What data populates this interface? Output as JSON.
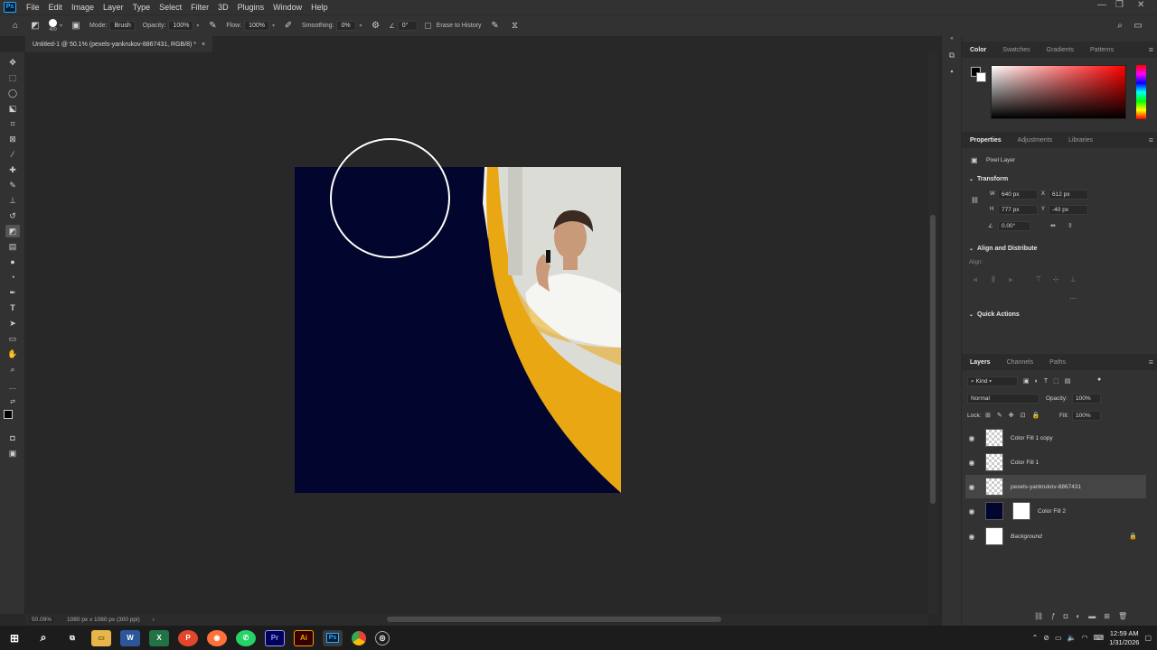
{
  "menubar": {
    "logo": "Ps",
    "items": [
      "File",
      "Edit",
      "Image",
      "Layer",
      "Type",
      "Select",
      "Filter",
      "3D",
      "Plugins",
      "Window",
      "Help"
    ]
  },
  "options": {
    "brush_size": "400",
    "mode_label": "Mode:",
    "mode_value": "Brush",
    "opacity_label": "Opacity:",
    "opacity_value": "100%",
    "flow_label": "Flow:",
    "flow_value": "100%",
    "smoothing_label": "Smoothing:",
    "smoothing_value": "0%",
    "angle_value": "0°",
    "erase_history_label": "Erase to History"
  },
  "document_tab": {
    "title": "Untitled-1 @ 50.1% (pexels-yankrukov-8867431, RGB/8) *",
    "close": "×"
  },
  "status": {
    "zoom": "50.09%",
    "doc_info": "1080 px x 1080 px (300 ppi)"
  },
  "color_panel": {
    "tabs": [
      "Color",
      "Swatches",
      "Gradients",
      "Patterns"
    ],
    "foreground": "#000000",
    "background": "#ffffff"
  },
  "properties_panel": {
    "tabs": [
      "Properties",
      "Adjustments",
      "Libraries"
    ],
    "layer_kind": "Pixel Layer",
    "transform_title": "Transform",
    "w_label": "W",
    "w_value": "640 px",
    "h_label": "H",
    "h_value": "777 px",
    "x_label": "X",
    "x_value": "612 px",
    "y_label": "Y",
    "y_value": "-40 px",
    "angle_value": "0.00°",
    "align_title": "Align and Distribute",
    "align_label": "Align:",
    "quick_actions_title": "Quick Actions"
  },
  "layers_panel": {
    "tabs": [
      "Layers",
      "Channels",
      "Paths"
    ],
    "filter_kind": "Kind",
    "blend_mode": "Normal",
    "opacity_label": "Opacity:",
    "opacity_value": "100%",
    "lock_label": "Lock:",
    "fill_label": "Fill:",
    "fill_value": "100%",
    "layers": [
      {
        "name": "Color Fill 1 copy",
        "selected": false
      },
      {
        "name": "Color Fill 1",
        "selected": false
      },
      {
        "name": "pexels-yankrukov-8867431",
        "selected": true
      },
      {
        "name": "Color Fill 2",
        "selected": false
      },
      {
        "name": "Background",
        "selected": false
      }
    ]
  },
  "taskbar": {
    "time": "12:59 AM",
    "date": "1/31/2026",
    "apps": [
      "Start",
      "Search",
      "Task View",
      "File Explorer",
      "Word",
      "Excel",
      "PDF",
      "Firefox",
      "WhatsApp",
      "Premiere Pro",
      "Illustrator",
      "Photoshop",
      "Chrome",
      "Capture"
    ]
  },
  "colors": {
    "navy": "#02062e",
    "orange": "#e9a714",
    "ui_bg": "#323232",
    "canvas_bg": "#282828"
  }
}
